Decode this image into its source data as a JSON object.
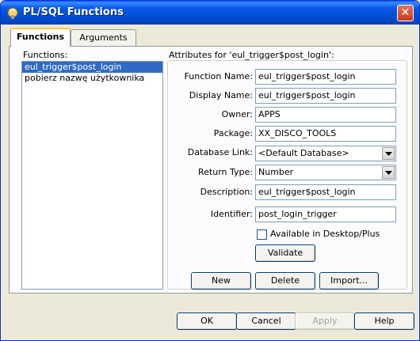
{
  "window": {
    "title": "PL/SQL Functions",
    "close_glyph": "✕"
  },
  "tabs": [
    {
      "label": "Functions",
      "active": true
    },
    {
      "label": "Arguments",
      "active": false
    }
  ],
  "functions_list": {
    "label": "Functions:",
    "items": [
      {
        "label": "eul_trigger$post_login",
        "selected": true
      },
      {
        "label": "pobierz nazwę użytkownika",
        "selected": false
      }
    ]
  },
  "attributes": {
    "heading": "Attributes for 'eul_trigger$post_login':",
    "function_name": {
      "label": "Function Name:",
      "value": "eul_trigger$post_login"
    },
    "display_name": {
      "label": "Display Name:",
      "value": "eul_trigger$post_login"
    },
    "owner": {
      "label": "Owner:",
      "value": "APPS"
    },
    "package": {
      "label": "Package:",
      "value": "XX_DISCO_TOOLS"
    },
    "database_link": {
      "label": "Database Link:",
      "value": "<Default Database>"
    },
    "return_type": {
      "label": "Return Type:",
      "value": "Number"
    },
    "description": {
      "label": "Description:",
      "value": "eul_trigger$post_login"
    },
    "identifier": {
      "label": "Identifier:",
      "value": "post_login_trigger"
    },
    "available_checkbox": {
      "label": "Available in Desktop/Plus",
      "checked": false
    },
    "validate_button": "Validate"
  },
  "panel_buttons": {
    "new": "New",
    "delete": "Delete",
    "import": "Import..."
  },
  "dialog_buttons": {
    "ok": "OK",
    "cancel": "Cancel",
    "apply": "Apply",
    "help": "Help"
  },
  "colors": {
    "titlebar": "#0054e3",
    "selection": "#316ac5",
    "tab_highlight": "#ffc83c",
    "dialog_bg": "#ece9d8"
  },
  "icons": {
    "title_icon": "function-icon",
    "close": "close-icon",
    "dropdown": "chevron-down-icon"
  }
}
